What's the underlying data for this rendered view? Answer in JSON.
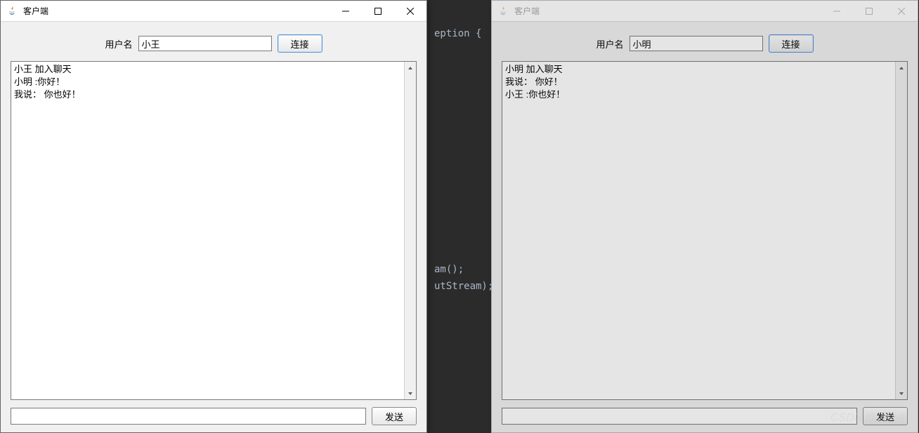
{
  "background_code": {
    "line1_suffix": "eption {",
    "line2_suffix": "am();",
    "line3_suffix": "utStream);"
  },
  "windows": [
    {
      "title": "客户端",
      "username_label": "用户名",
      "username_value": "小王",
      "connect_btn": "连接",
      "chat_lines": [
        "小王 加入聊天",
        "小明 :你好！",
        "我说： 你也好！"
      ],
      "message_value": "",
      "send_btn": "发送"
    },
    {
      "title": "客户端",
      "username_label": "用户名",
      "username_value": "小明",
      "connect_btn": "连接",
      "chat_lines": [
        "小明 加入聊天",
        "我说： 你好！",
        "小王 :你也好！"
      ],
      "message_value": "",
      "send_btn": "发送"
    }
  ],
  "watermark": "CSDN @Li~~#"
}
